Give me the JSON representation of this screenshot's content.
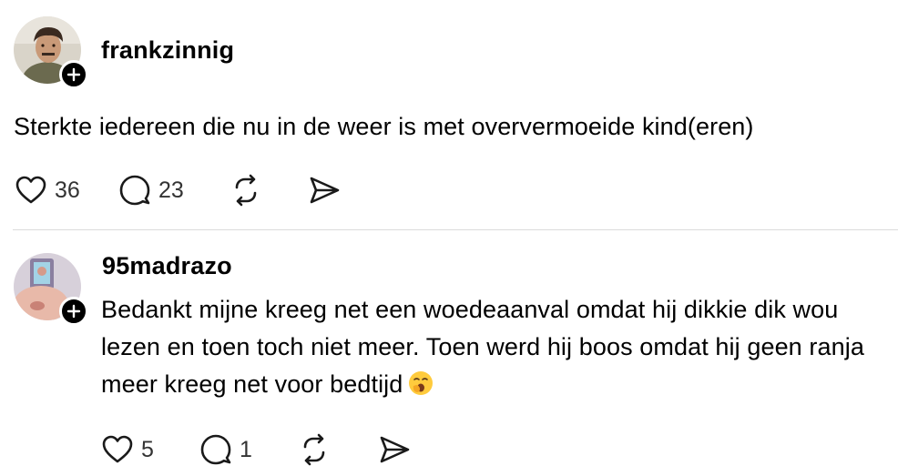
{
  "posts": [
    {
      "username": "frankzinnig",
      "text": "Sterkte iedereen die nu in de weer is met oververmoeide kind(eren)",
      "likes": "36",
      "replies": "23",
      "avatar_icon": "profile-photo-man"
    },
    {
      "username": "95madrazo",
      "text": "Bedankt mijne kreeg net een woedeaanval omdat hij dikkie dik wou lezen en toen toch niet meer. Toen werd hij boos omdat hij geen ranja meer kreeg net voor bedtijd",
      "emoji": "yawning-face-emoji",
      "likes": "5",
      "replies": "1",
      "avatar_icon": "profile-photo-child"
    }
  ],
  "colors": {
    "text": "#000000",
    "muted": "#333333",
    "divider": "#dcdcdc"
  }
}
